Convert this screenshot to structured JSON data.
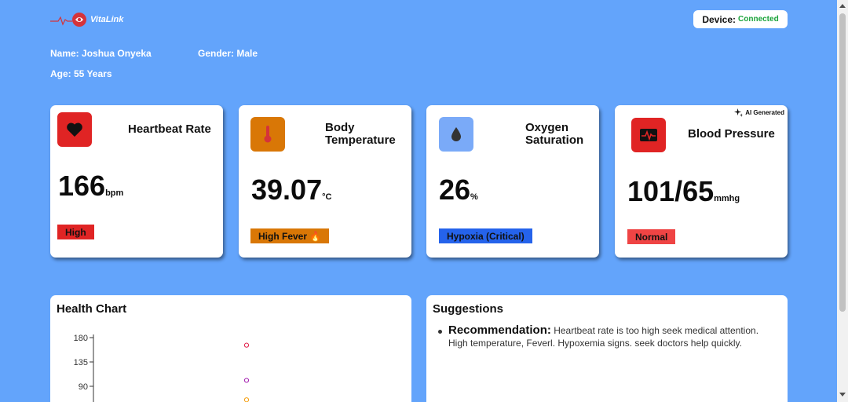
{
  "header": {
    "brand": "VitaLink",
    "device_label": "Device:",
    "device_status": "Connected"
  },
  "patient": {
    "name": "Name: Joshua Onyeka",
    "gender": "Gender: Male",
    "age": "Age: 55 Years"
  },
  "cards": [
    {
      "title": "Heartbeat Rate",
      "value": "166",
      "unit": "bpm",
      "status": "High",
      "icon": "heart-icon",
      "status_color": "#e02424"
    },
    {
      "title_line1": "Body",
      "title_line2": "Temperature",
      "value": "39.07",
      "unit": "°C",
      "status": "High Fever 🔥",
      "icon": "thermometer-icon",
      "status_color": "#d97706"
    },
    {
      "title_line1": "Oxygen",
      "title_line2": "Saturation",
      "value": "26",
      "unit": "%",
      "status": "Hypoxia (Critical)",
      "icon": "water-drop-icon",
      "status_color": "#2563eb"
    },
    {
      "title": "Blood Pressure",
      "value": "101/65",
      "unit": "mmhg",
      "status": "Normal",
      "icon": "heart-monitor-icon",
      "status_color": "#ef4444",
      "ai_tag": "AI Generated"
    }
  ],
  "health_chart": {
    "title": "Health Chart"
  },
  "suggestions": {
    "title": "Suggestions",
    "label": "Recommendation:",
    "text": "Heartbeat rate is too high seek medical attention. High temperature, Feverl. Hypoxemia signs. seek doctors help quickly."
  },
  "chart_data": {
    "type": "scatter",
    "title": "",
    "xlabel": "",
    "ylabel": "",
    "ylim": [
      0,
      180
    ],
    "yticks": [
      "180",
      "135",
      "90"
    ],
    "series": [
      {
        "values": [
          166
        ],
        "color": "#e11d48"
      },
      {
        "values": [
          101
        ],
        "color": "#a21caf"
      },
      {
        "values": [
          65
        ],
        "color": "#f59e0b"
      }
    ]
  }
}
